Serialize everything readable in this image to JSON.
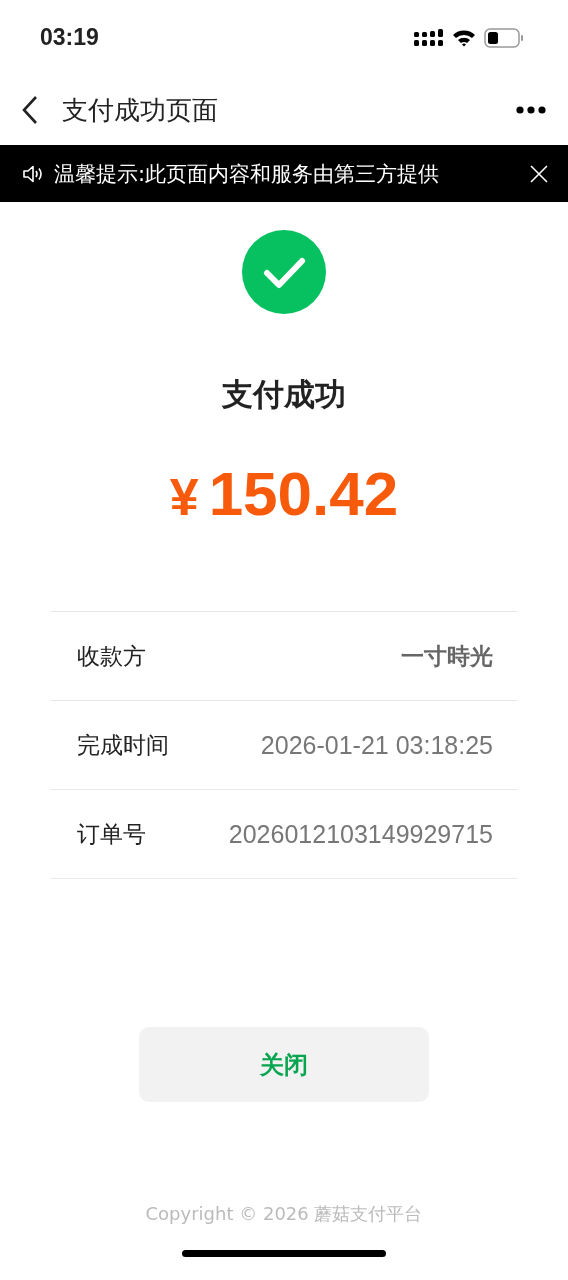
{
  "status_bar": {
    "time": "03:19"
  },
  "nav": {
    "title": "支付成功页面"
  },
  "notice": {
    "text": "温馨提示:此页面内容和服务由第三方提供"
  },
  "result": {
    "title": "支付成功",
    "amount_symbol": "¥",
    "amount": "150.42"
  },
  "details": [
    {
      "label": "收款方",
      "value": "一寸時光",
      "bold": true
    },
    {
      "label": "完成时间",
      "value": "2026-01-21 03:18:25",
      "bold": false
    },
    {
      "label": "订单号",
      "value": "2026012103149929715",
      "bold": false
    }
  ],
  "close_button": {
    "label": "关闭"
  },
  "footer": {
    "text": "Copyright © 2026 蘑菇支付平台"
  }
}
